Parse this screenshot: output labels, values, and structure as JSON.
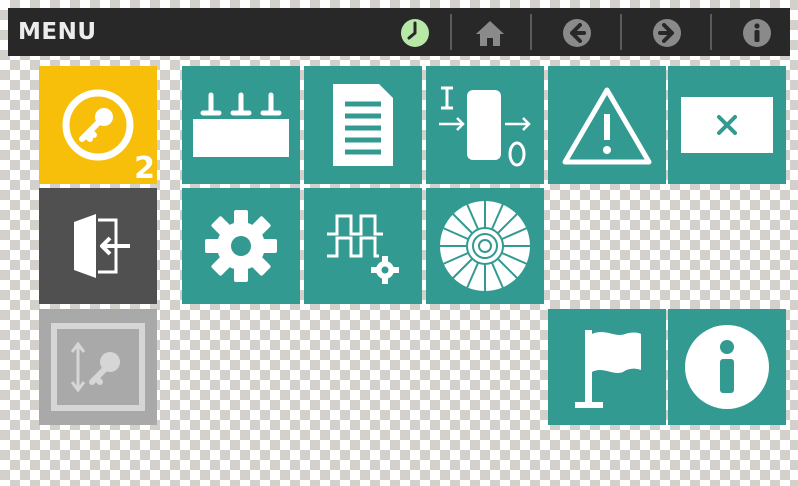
{
  "header": {
    "title": "MENU"
  },
  "toolbar": {
    "icons": [
      "clock-icon",
      "home-icon",
      "arrow-left-icon",
      "arrow-right-icon",
      "info-icon"
    ]
  },
  "sidebar": {
    "key_tile": {
      "icon": "key-icon",
      "badge": "2",
      "color": "#f7bf09"
    },
    "exit_tile": {
      "icon": "exit-door-icon",
      "color": "#505050"
    },
    "access_tile": {
      "icon": "key-resize-icon",
      "color": "#a9a9a9"
    }
  },
  "colors": {
    "header_bg": "#282828",
    "tile_teal": "#339a92",
    "clock_green": "#b8e8a8"
  },
  "tiles": [
    "press-icon",
    "document-icon",
    "io-module-icon",
    "warning-icon",
    "close-window-icon",
    "gear-icon",
    "signal-settings-icon",
    "disc-icon",
    "flag-icon",
    "info-icon"
  ]
}
